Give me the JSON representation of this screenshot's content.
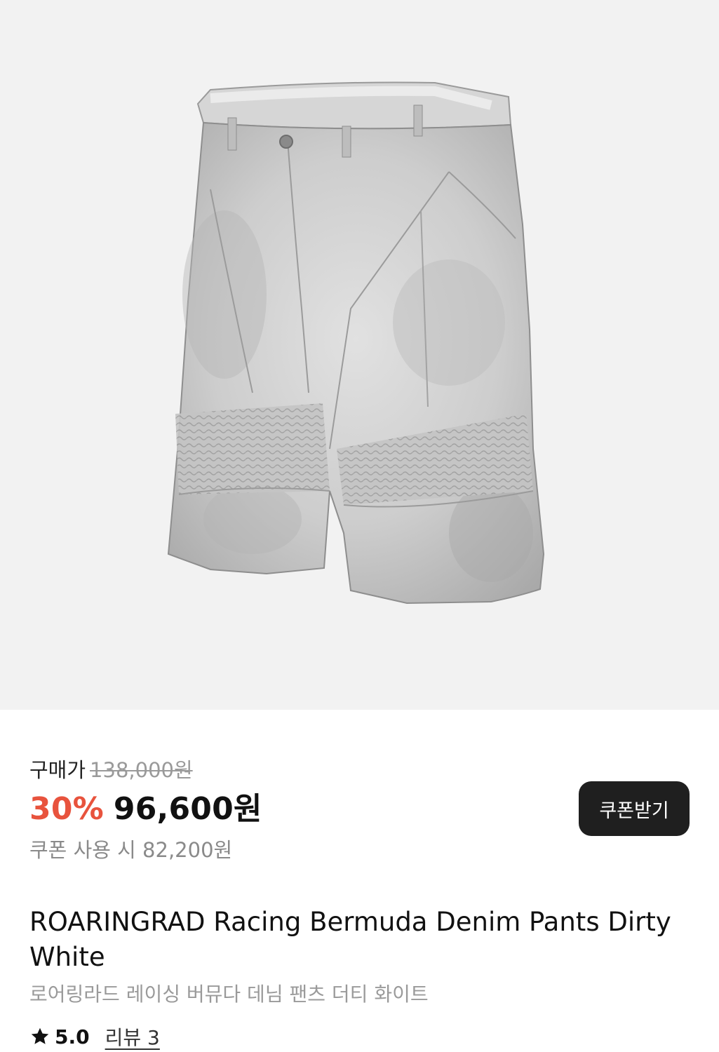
{
  "product_image": {
    "alt": "ROARINGRAD Racing Bermuda Denim Pants Dirty White",
    "background": "#f2f2f2",
    "garment_color": "#c9c9c9"
  },
  "pricing": {
    "label": "구매가",
    "original_price": "138,000원",
    "discount_percent": "30%",
    "sale_price": "96,600원",
    "coupon_price_text": "쿠폰 사용 시 82,200원",
    "discount_color": "#e8533d"
  },
  "coupon_button": {
    "label": "쿠폰받기"
  },
  "product": {
    "title": "ROARINGRAD Racing Bermuda Denim Pants Dirty White",
    "subtitle": "로어링라드 레이싱 버뮤다 데님 팬츠 더티 화이트"
  },
  "rating": {
    "icon": "star-icon",
    "score": "5.0",
    "reviews_label": "리뷰 3"
  }
}
